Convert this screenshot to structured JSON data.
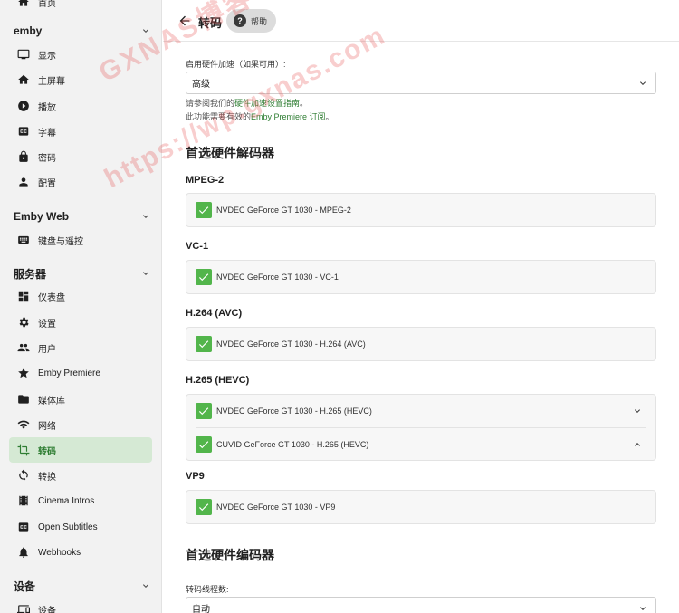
{
  "sidebar": {
    "top_item": "首页",
    "sections": [
      {
        "title": "emby",
        "items": [
          "显示",
          "主屏幕",
          "播放",
          "字幕",
          "密码",
          "配置"
        ]
      },
      {
        "title": "Emby Web",
        "items": [
          "键盘与遥控"
        ]
      },
      {
        "title": "服务器",
        "items": [
          "仪表盘",
          "设置",
          "用户",
          "Emby Premiere",
          "媒体库",
          "网络",
          "转码",
          "转换",
          "Cinema Intros",
          "Open Subtitles",
          "Webhooks"
        ]
      },
      {
        "title": "设备",
        "items": [
          "设备"
        ]
      }
    ],
    "active_item": "转码"
  },
  "header": {
    "title": "转码",
    "help_label": "帮助"
  },
  "hw_accel": {
    "label": "启用硬件加速（如果可用）:",
    "value": "高级",
    "hint1_prefix": "请参阅我们的",
    "hint1_link": "硬件加速设置指南",
    "hint1_suffix": "。",
    "hint2_prefix": "此功能需要有效的",
    "hint2_link": "Emby Premiere 订阅",
    "hint2_suffix": "。"
  },
  "decoders": {
    "title": "首选硬件解码器",
    "groups": [
      {
        "name": "MPEG-2",
        "items": [
          "NVDEC GeForce GT 1030 - MPEG-2"
        ]
      },
      {
        "name": "VC-1",
        "items": [
          "NVDEC GeForce GT 1030 - VC-1"
        ]
      },
      {
        "name": "H.264 (AVC)",
        "items": [
          "NVDEC GeForce GT 1030 - H.264 (AVC)"
        ]
      },
      {
        "name": "H.265 (HEVC)",
        "items": [
          "NVDEC GeForce GT 1030 - H.265 (HEVC)",
          "CUVID GeForce GT 1030 - H.265 (HEVC)"
        ]
      },
      {
        "name": "VP9",
        "items": [
          "NVDEC GeForce GT 1030 - VP9"
        ]
      }
    ]
  },
  "encoders": {
    "title": "首选硬件编码器",
    "threads_label": "转码线程数:",
    "threads_value": "自动"
  },
  "watermark": {
    "line1": "GXNAS博客",
    "line2": "https://wp.gxnas.com"
  },
  "colors": {
    "accent": "#52b54b",
    "active_bg": "#d5e9d4",
    "link": "#2e7d32"
  }
}
